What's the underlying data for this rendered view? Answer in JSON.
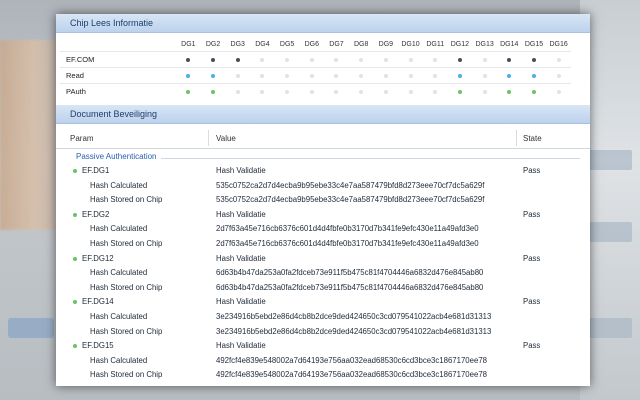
{
  "chip_section": {
    "title": "Chip Lees Informatie",
    "columns": [
      "DG1",
      "DG2",
      "DG3",
      "DG4",
      "DG5",
      "DG6",
      "DG7",
      "DG8",
      "DG9",
      "DG10",
      "DG11",
      "DG12",
      "DG13",
      "DG14",
      "DG15",
      "DG16"
    ],
    "rows": [
      {
        "label": "EF.COM",
        "color": "dark",
        "present": [
          1,
          1,
          1,
          0,
          0,
          0,
          0,
          0,
          0,
          0,
          0,
          1,
          0,
          1,
          1,
          0
        ]
      },
      {
        "label": "Read",
        "color": "blue",
        "present": [
          1,
          1,
          0,
          0,
          0,
          0,
          0,
          0,
          0,
          0,
          0,
          1,
          0,
          1,
          1,
          0
        ]
      },
      {
        "label": "PAuth",
        "color": "green",
        "present": [
          1,
          1,
          0,
          0,
          0,
          0,
          0,
          0,
          0,
          0,
          0,
          1,
          0,
          1,
          1,
          0
        ]
      }
    ]
  },
  "security_section": {
    "title": "Document Beveiliging",
    "col_param": "Param",
    "col_value": "Value",
    "col_state": "State",
    "group_label": "Passive Authentication",
    "rows": [
      {
        "param": "EF.DG1",
        "value": "Hash Validatie",
        "state": "Pass",
        "kind": "main"
      },
      {
        "param": "Hash Calculated",
        "value": "535c0752ca2d7d4ecba9b95ebe33c4e7aa587479bfd8d273eee70cf7dc5a629f",
        "state": "",
        "kind": "sub"
      },
      {
        "param": "Hash Stored on Chip",
        "value": "535c0752ca2d7d4ecba9b95ebe33c4e7aa587479bfd8d273eee70cf7dc5a629f",
        "state": "",
        "kind": "sub"
      },
      {
        "param": "EF.DG2",
        "value": "Hash Validatie",
        "state": "Pass",
        "kind": "main"
      },
      {
        "param": "Hash Calculated",
        "value": "2d7f63a45e716cb6376c601d4d4fbfe0b3170d7b341fe9efc430e11a49afd3e0",
        "state": "",
        "kind": "sub"
      },
      {
        "param": "Hash Stored on Chip",
        "value": "2d7f63a45e716cb6376c601d4d4fbfe0b3170d7b341fe9efc430e11a49afd3e0",
        "state": "",
        "kind": "sub"
      },
      {
        "param": "EF.DG12",
        "value": "Hash Validatie",
        "state": "Pass",
        "kind": "main"
      },
      {
        "param": "Hash Calculated",
        "value": "6d63b4b47da253a0fa2fdceb73e911f5b475c81f4704446a6832d476e845ab80",
        "state": "",
        "kind": "sub"
      },
      {
        "param": "Hash Stored on Chip",
        "value": "6d63b4b47da253a0fa2fdceb73e911f5b475c81f4704446a6832d476e845ab80",
        "state": "",
        "kind": "sub"
      },
      {
        "param": "EF.DG14",
        "value": "Hash Validatie",
        "state": "Pass",
        "kind": "main"
      },
      {
        "param": "Hash Calculated",
        "value": "3e234916b5ebd2e86d4cb8b2dce9ded424650c3cd079541022acb4e681d31313",
        "state": "",
        "kind": "sub"
      },
      {
        "param": "Hash Stored on Chip",
        "value": "3e234916b5ebd2e86d4cb8b2dce9ded424650c3cd079541022acb4e681d31313",
        "state": "",
        "kind": "sub"
      },
      {
        "param": "EF.DG15",
        "value": "Hash Validatie",
        "state": "Pass",
        "kind": "main"
      },
      {
        "param": "Hash Calculated",
        "value": "492fcf4e839e548002a7d64193e756aa032ead68530c6cd3bce3c1867170ee78",
        "state": "",
        "kind": "sub"
      },
      {
        "param": "Hash Stored on Chip",
        "value": "492fcf4e839e548002a7d64193e756aa032ead68530c6cd3bce3c1867170ee78",
        "state": "",
        "kind": "sub"
      }
    ]
  }
}
